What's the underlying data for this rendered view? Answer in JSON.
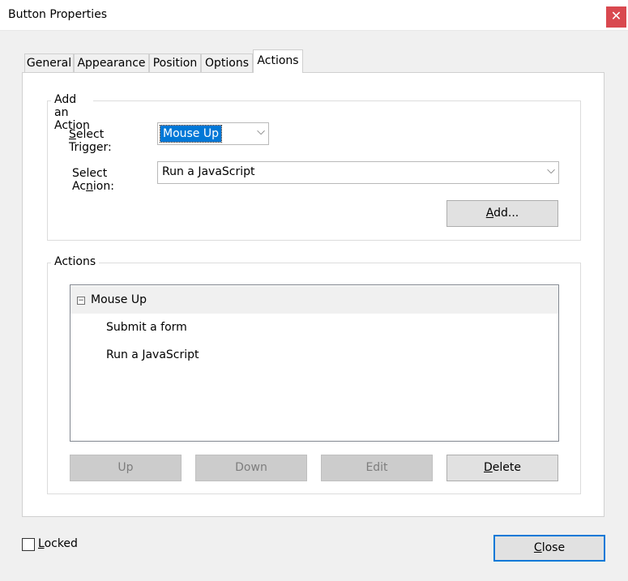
{
  "window": {
    "title": "Button Properties",
    "close_glyph": "✕"
  },
  "tabs": [
    {
      "label": "General"
    },
    {
      "label": "Appearance"
    },
    {
      "label": "Position"
    },
    {
      "label": "Options"
    },
    {
      "label": "Actions"
    }
  ],
  "add_action": {
    "title": "Add an Action",
    "trigger_label": "Select Trigger:",
    "trigger_value": "Mouse Up",
    "action_label": "Select Action:",
    "action_value": "Run a JavaScript",
    "add_button": "Add..."
  },
  "actions_group": {
    "title": "Actions",
    "tree": {
      "node": "Mouse Up",
      "children": [
        "Submit a form",
        "Run a JavaScript"
      ]
    },
    "buttons": {
      "up": "Up",
      "down": "Down",
      "edit": "Edit",
      "delete": "Delete"
    }
  },
  "footer": {
    "locked_label": "Locked",
    "locked_checked": false,
    "close_button": "Close"
  },
  "icons": {
    "chevron": "⌵",
    "collapse": "−"
  }
}
